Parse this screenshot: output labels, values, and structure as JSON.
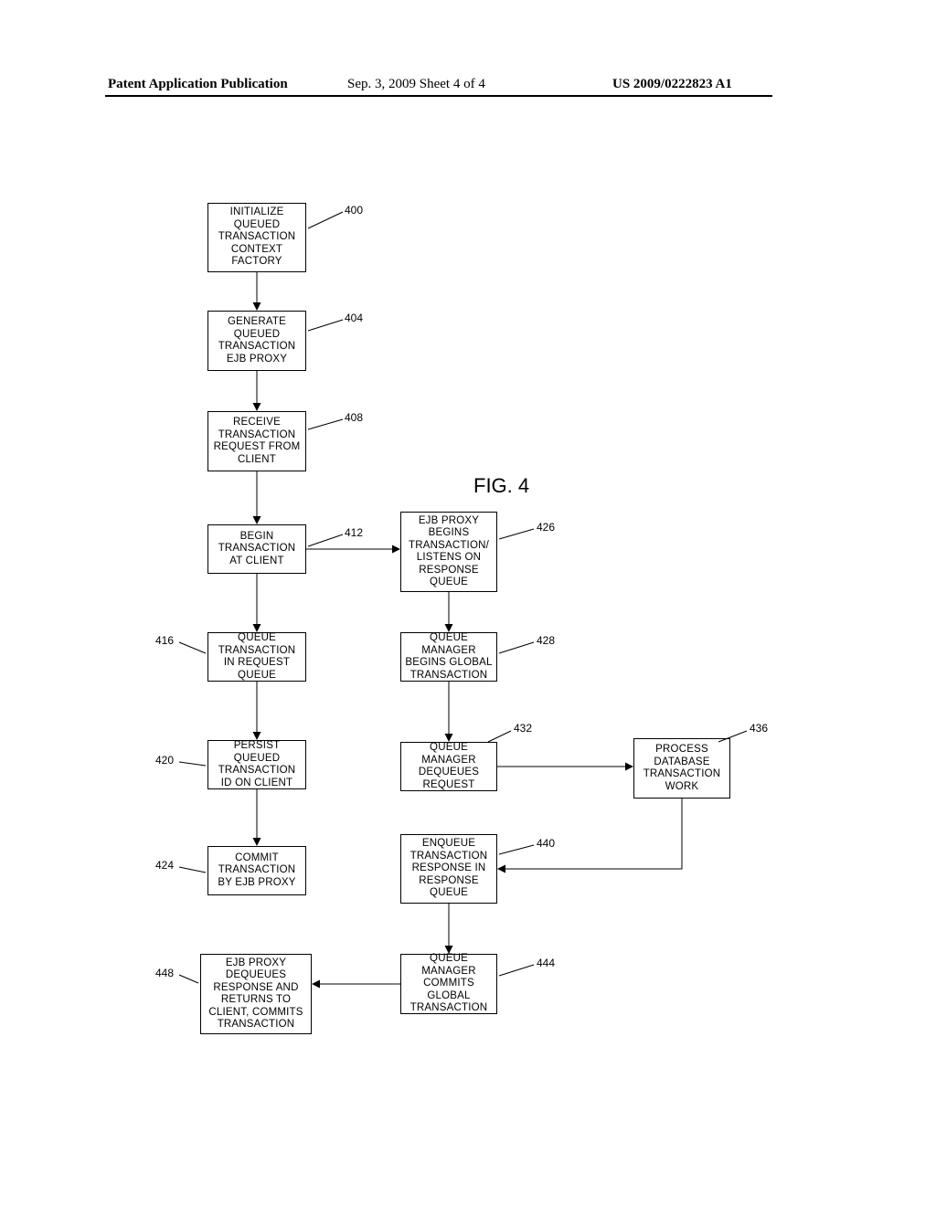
{
  "header": {
    "left": "Patent Application Publication",
    "center": "Sep. 3, 2009  Sheet 4 of 4",
    "right": "US 2009/0222823 A1"
  },
  "figure_title": "FIG. 4",
  "boxes": {
    "b400": "INITIALIZE QUEUED TRANSACTION CONTEXT FACTORY",
    "b404": "GENERATE QUEUED TRANSACTION EJB PROXY",
    "b408": "RECEIVE TRANSACTION REQUEST FROM CLIENT",
    "b412": "BEGIN TRANSACTION AT CLIENT",
    "b416_text": "QUEUE TRANSACTION IN REQUEST QUEUE",
    "b420": "PERSIST QUEUED TRANSACTION ID ON CLIENT",
    "b424": "COMMIT TRANSACTION BY EJB PROXY",
    "b426": "EJB PROXY BEGINS TRANSACTION/ LISTENS ON RESPONSE QUEUE",
    "b428": "QUEUE MANAGER BEGINS GLOBAL TRANSACTION",
    "b432": "QUEUE MANAGER DEQUEUES REQUEST",
    "b436": "PROCESS DATABASE TRANSACTION WORK",
    "b440": "ENQUEUE TRANSACTION RESPONSE IN RESPONSE QUEUE",
    "b444": "QUEUE MANAGER COMMITS GLOBAL TRANSACTION",
    "b448": "EJB PROXY DEQUEUES RESPONSE AND RETURNS TO CLIENT, COMMITS TRANSACTION"
  },
  "labels": {
    "l400": "400",
    "l404": "404",
    "l408": "408",
    "l412": "412",
    "l416": "416",
    "l420": "420",
    "l424": "424",
    "l426": "426",
    "l428": "428",
    "l432": "432",
    "l436": "436",
    "l440": "440",
    "l444": "444",
    "l448": "448"
  }
}
